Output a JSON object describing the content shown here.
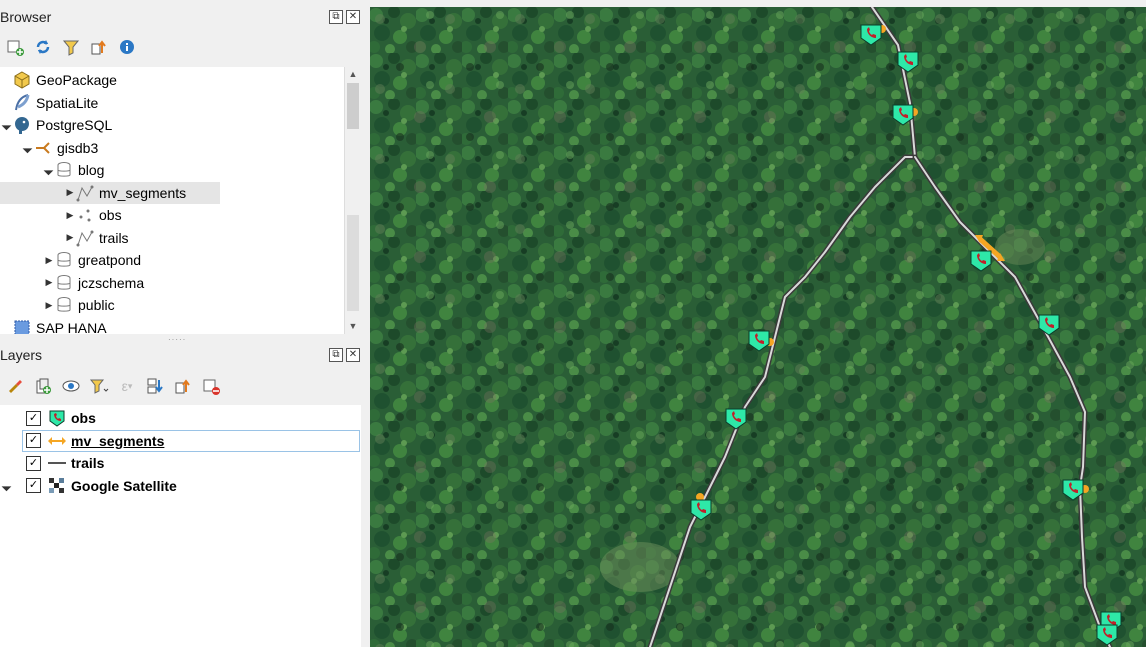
{
  "browser_panel": {
    "title": "Browser",
    "dock_buttons": [
      "float-icon",
      "close-icon"
    ],
    "toolbar": [
      "add-layer-icon",
      "refresh-icon",
      "filter-icon",
      "collapse-all-icon",
      "properties-icon"
    ],
    "items": [
      {
        "label": "GeoPackage",
        "icon": "geopackage-icon",
        "level": 0,
        "expander": "none"
      },
      {
        "label": "SpatiaLite",
        "icon": "spatialite-feather-icon",
        "level": 0,
        "expander": "none"
      },
      {
        "label": "PostgreSQL",
        "icon": "postgresql-elephant-icon",
        "level": 0,
        "expander": "expanded"
      },
      {
        "label": "gisdb3",
        "icon": "connection-icon",
        "level": 1,
        "expander": "expanded"
      },
      {
        "label": "blog",
        "icon": "schema-icon",
        "level": 2,
        "expander": "expanded"
      },
      {
        "label": "mv_segments",
        "icon": "line-layer-icon",
        "level": 3,
        "expander": "collapsed",
        "selected": true
      },
      {
        "label": "obs",
        "icon": "point-layer-icon",
        "level": 3,
        "expander": "collapsed"
      },
      {
        "label": "trails",
        "icon": "line-layer-icon",
        "level": 3,
        "expander": "collapsed"
      },
      {
        "label": "greatpond",
        "icon": "schema-icon",
        "level": 2,
        "expander": "collapsed"
      },
      {
        "label": "jczschema",
        "icon": "schema-icon",
        "level": 2,
        "expander": "collapsed"
      },
      {
        "label": "public",
        "icon": "schema-icon",
        "level": 2,
        "expander": "collapsed"
      },
      {
        "label": "SAP HANA",
        "icon": "sap-hana-icon",
        "level": 0,
        "expander": "none"
      }
    ]
  },
  "layers_panel": {
    "title": "Layers",
    "toolbar": [
      "style-brush-icon",
      "add-group-icon",
      "visibility-eye-icon",
      "filter-legend-icon",
      "expression-filter-icon",
      "expand-all-icon",
      "collapse-all-icon",
      "remove-layer-icon"
    ],
    "layers": [
      {
        "label": "obs",
        "icon": "phone-marker-icon",
        "checked": true,
        "underlined": false,
        "expander": "none"
      },
      {
        "label": "mv_segments",
        "icon": "double-arrow-icon",
        "checked": true,
        "underlined": true,
        "expander": "none",
        "selected": true
      },
      {
        "label": "trails",
        "icon": "line-symbol-icon",
        "checked": true,
        "underlined": false,
        "expander": "none"
      },
      {
        "label": "Google Satellite",
        "icon": "raster-tile-icon",
        "checked": true,
        "underlined": false,
        "expander": "expanded"
      }
    ]
  },
  "map": {
    "background": "satellite-forest",
    "colors": {
      "forest_dark": "#1f4a2c",
      "forest_mid": "#2f6b3a",
      "trail": "#d9d9d9",
      "marker_fill": "#2ee8a8",
      "segment": "#f5a623"
    }
  }
}
